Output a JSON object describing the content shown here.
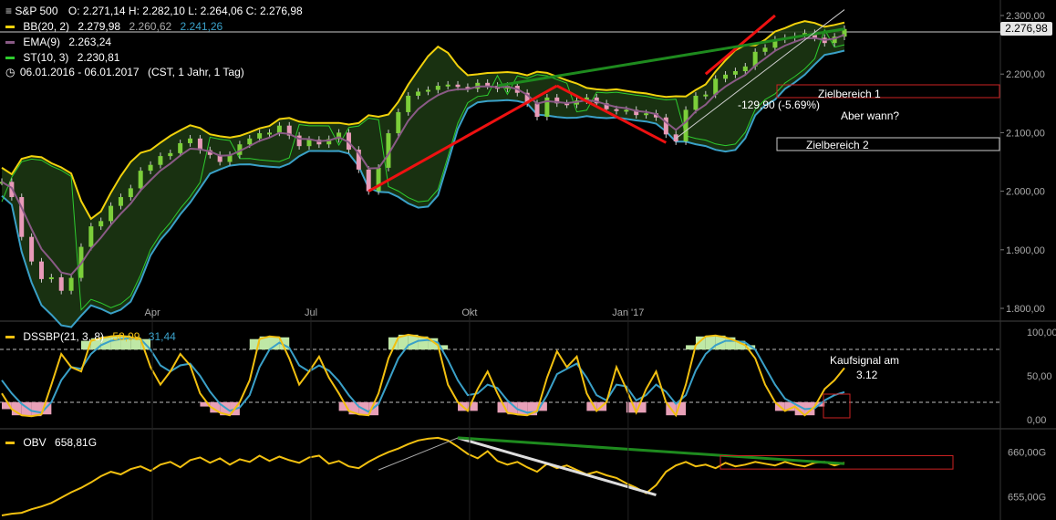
{
  "header": {
    "symbol": "S&P 500",
    "ohlc": "O: 2.271,14   H: 2.282,10   L: 2.264,06   C: 2.276,98",
    "bb_label": "BB(20, 2)",
    "bb_mid": "2.279,98",
    "bb_upper": "2.260,62",
    "bb_lower": "2.241,26",
    "ema_label": "EMA(9)",
    "ema_value": "2.263,24",
    "st_label": "ST(10, 3)",
    "st_value": "2.230,81",
    "range": "06.01.2016 - 06.01.2017",
    "range_detail": "(CST, 1 Jahr, 1 Tag)"
  },
  "price_tag": "2.276,98",
  "annotations": {
    "zielbereich1": "Zielbereich 1",
    "zielbereich2": "Zielbereich 2",
    "aber_wann": "Aber wann?",
    "change": "-129,90 (-5.69%)",
    "kaufsignal_line1": "Kaufsignal am",
    "kaufsignal_line2": "3.12"
  },
  "osc_legend": {
    "label": "DSSBP(21, 3, 8)",
    "v1": "58,99",
    "v2": "31,44"
  },
  "obv_legend": {
    "label": "OBV",
    "value": "658,81G"
  },
  "colors": {
    "background": "#000000",
    "bb_band": "#f2d20c",
    "bb_lower": "#3aa0c8",
    "ema": "#8a5a86",
    "supertrend_up": "#2ecc2e",
    "supertrend_down": "#c01818",
    "trend_green": "#1e8a1e",
    "trend_red": "#ee1111",
    "candle_up": "#7ccf3a",
    "candle_down": "#e89ab8",
    "osc_fast": "#f2c010",
    "osc_slow": "#3aa0c8",
    "obv": "#f2c010"
  },
  "chart_data": [
    {
      "type": "line",
      "title": "S&P 500",
      "x_ticks": [
        "Apr",
        "Jul",
        "Okt",
        "Jan '17"
      ],
      "y_ticks": [
        "1.800,00",
        "1.900,00",
        "2.000,00",
        "2.100,00",
        "2.200,00",
        "2.300,00"
      ],
      "ylim": [
        1790,
        2315
      ],
      "grid": false,
      "series": [
        {
          "name": "S&P 500",
          "values": [
            2016,
            1990,
            1922,
            1880,
            1850,
            1853,
            1830,
            1852,
            1905,
            1940,
            1949,
            1975,
            1990,
            2005,
            2035,
            2045,
            2060,
            2065,
            2082,
            2090,
            2070,
            2062,
            2050,
            2062,
            2080,
            2090,
            2099,
            2100,
            2112,
            2095,
            2077,
            2088,
            2080,
            2089,
            2100,
            2071,
            2037,
            2000,
            2040,
            2099,
            2135,
            2163,
            2170,
            2173,
            2180,
            2182,
            2178,
            2175,
            2185,
            2180,
            2175,
            2180,
            2168,
            2150,
            2127,
            2160,
            2150,
            2148,
            2155,
            2160,
            2150,
            2140,
            2137,
            2139,
            2130,
            2133,
            2126,
            2097,
            2085,
            2139,
            2163,
            2165,
            2192,
            2199,
            2205,
            2213,
            2238,
            2245,
            2259,
            2262,
            2265,
            2270,
            2262,
            2253,
            2264,
            2277
          ]
        }
      ],
      "extra": {
        "bollinger": [
          "BB(20, 2)"
        ],
        "ema": "EMA(9)",
        "supertrend": "ST(10, 3)",
        "change": "-129,90 (-5.69%)",
        "targets": [
          "Zielbereich 1",
          "Zielbereich 2"
        ]
      }
    },
    {
      "type": "line",
      "title": "DSSBP(21, 3, 8)",
      "y_ticks": [
        "0,00",
        "50,00",
        "100,00"
      ],
      "ylim": [
        -5,
        105
      ],
      "series": [
        {
          "name": "DSSBP fast",
          "values": [
            30,
            12,
            5,
            4,
            6,
            40,
            75,
            60,
            55,
            90,
            93,
            95,
            96,
            94,
            92,
            60,
            40,
            55,
            75,
            62,
            30,
            15,
            8,
            5,
            20,
            45,
            92,
            95,
            94,
            70,
            40,
            55,
            72,
            48,
            30,
            10,
            6,
            5,
            30,
            70,
            94,
            97,
            95,
            93,
            85,
            40,
            20,
            10,
            35,
            55,
            30,
            8,
            6,
            5,
            10,
            48,
            78,
            60,
            72,
            30,
            10,
            20,
            60,
            35,
            8,
            35,
            55,
            20,
            5,
            40,
            85,
            95,
            96,
            94,
            90,
            85,
            70,
            40,
            20,
            10,
            15,
            5,
            15,
            35,
            45,
            58.99
          ]
        },
        {
          "name": "DSSBP slow",
          "values": [
            45,
            30,
            18,
            10,
            8,
            20,
            45,
            60,
            58,
            75,
            85,
            90,
            92,
            93,
            92,
            80,
            62,
            55,
            62,
            64,
            50,
            32,
            18,
            10,
            14,
            28,
            60,
            80,
            88,
            82,
            62,
            55,
            62,
            56,
            44,
            28,
            15,
            9,
            18,
            44,
            70,
            85,
            90,
            91,
            88,
            68,
            45,
            28,
            30,
            40,
            36,
            22,
            12,
            8,
            9,
            28,
            52,
            58,
            64,
            48,
            28,
            22,
            40,
            38,
            22,
            28,
            40,
            32,
            18,
            28,
            56,
            75,
            85,
            90,
            90,
            88,
            80,
            60,
            40,
            24,
            18,
            12,
            13,
            22,
            28,
            31.44
          ]
        }
      ]
    },
    {
      "type": "line",
      "title": "OBV",
      "y_ticks": [
        "655,00G",
        "660,00G"
      ],
      "ylim": [
        652.8,
        662.0
      ],
      "series": [
        {
          "name": "OBV",
          "values": [
            652.9,
            653.1,
            653.2,
            653.6,
            653.9,
            654.3,
            654.9,
            655.5,
            656.0,
            656.6,
            657.3,
            657.8,
            657.5,
            658.1,
            658.4,
            657.9,
            658.6,
            658.9,
            658.3,
            659.1,
            659.4,
            658.8,
            659.3,
            658.6,
            659.2,
            658.9,
            659.6,
            659.0,
            659.5,
            659.1,
            658.8,
            659.4,
            659.6,
            658.7,
            659.0,
            658.4,
            658.2,
            658.9,
            659.5,
            660.0,
            660.4,
            660.9,
            661.3,
            661.5,
            661.6,
            661.3,
            660.6,
            659.8,
            659.3,
            660.1,
            659.0,
            658.6,
            658.9,
            658.3,
            657.8,
            658.7,
            658.2,
            658.5,
            658.0,
            657.5,
            657.8,
            657.4,
            657.1,
            656.5,
            656.0,
            655.4,
            656.3,
            657.8,
            658.5,
            658.9,
            658.4,
            658.6,
            658.2,
            658.8,
            658.4,
            658.6,
            658.9,
            658.7,
            658.5,
            658.9,
            658.6,
            658.4,
            658.8,
            658.9,
            658.5,
            658.81
          ]
        }
      ]
    }
  ]
}
